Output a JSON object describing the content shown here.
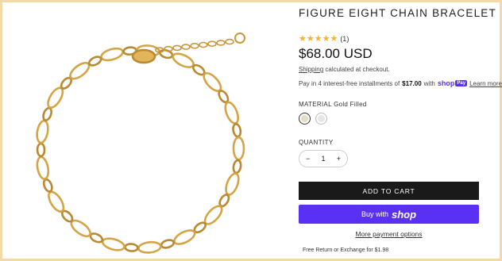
{
  "product": {
    "title": "FIGURE EIGHT CHAIN BRACELET",
    "stars": "★★★★★",
    "review_count": "(1)",
    "price": "$68.00 USD",
    "shipping_link": "Shipping",
    "shipping_rest": " calculated at checkout.",
    "installments_prefix": "Pay in 4 interest-free installments of",
    "installments_amount": "$17.00",
    "installments_with": "with",
    "shop_word": "shop",
    "shop_pay": "Pay",
    "learn_more": "Learn more",
    "material_label": "MATERIAL",
    "material_value": "Gold Filled",
    "swatch_colors": [
      "#e9dcc6",
      "#e6e6ea"
    ],
    "quantity_label": "QUANTITY",
    "quantity_minus": "−",
    "quantity_value": "1",
    "quantity_plus": "+",
    "add_to_cart": "ADD TO CART",
    "buy_with": "Buy with",
    "buy_shop": "shop",
    "more_payment": "More payment options",
    "free_return": "Free Return or Exchange for $1.98"
  },
  "colors": {
    "accent_shop": "#5a31f4",
    "cart_button": "#1a1a1a",
    "frame": "#f2d9a6",
    "gold": "#d9a84a"
  }
}
